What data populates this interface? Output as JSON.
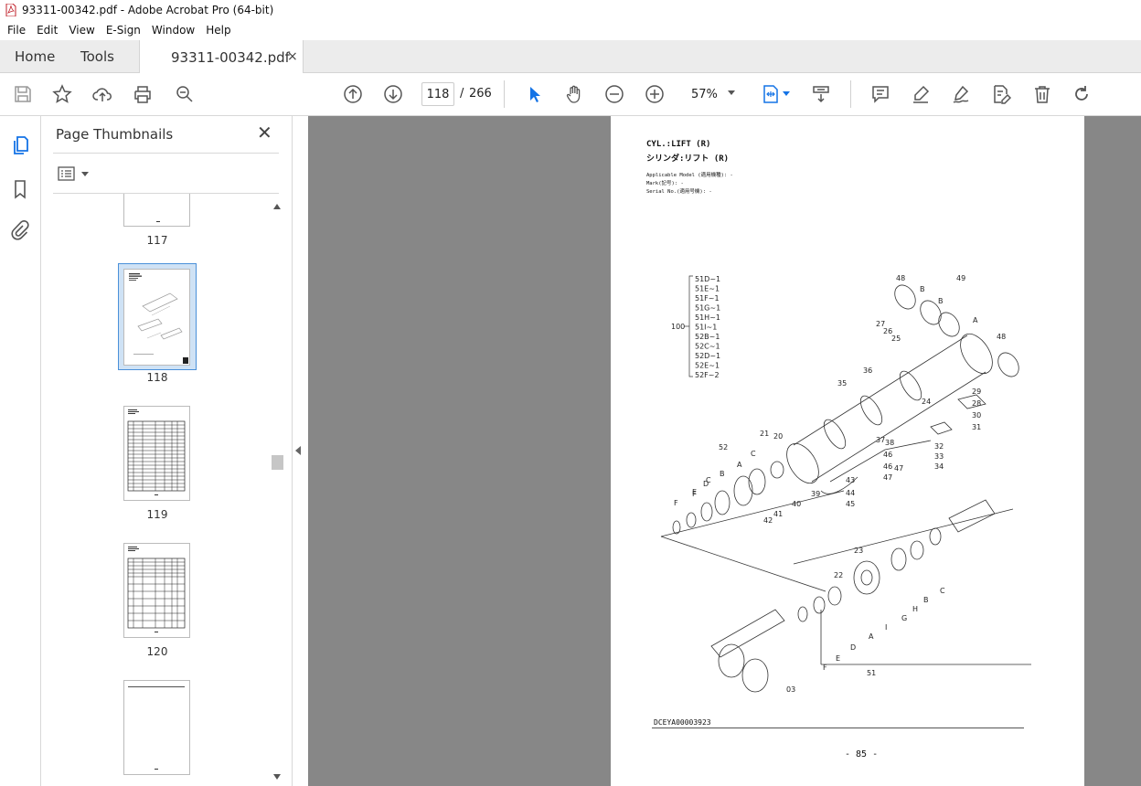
{
  "window": {
    "title": "93311-00342.pdf - Adobe Acrobat Pro (64-bit)"
  },
  "menu": [
    "File",
    "Edit",
    "View",
    "E-Sign",
    "Window",
    "Help"
  ],
  "tabs": {
    "home": "Home",
    "tools": "Tools",
    "document": "93311-00342.pdf",
    "close": "×"
  },
  "toolbar": {
    "page_current": "118",
    "page_sep": "/",
    "page_total": "266",
    "zoom": "57%"
  },
  "panel": {
    "title": "Page Thumbnails",
    "close": "✕",
    "thumbnails": [
      {
        "label": "117"
      },
      {
        "label": "118",
        "selected": true
      },
      {
        "label": "119"
      },
      {
        "label": "120"
      }
    ]
  },
  "document": {
    "heading_en": "CYL.:LIFT (R)",
    "heading_jp": "シリンダ:リフト (R)",
    "applicable_model": "Applicable Model (適用機種): -",
    "mark": "Mark(記号): -",
    "serial_no": "Serial No.(適用号機): -",
    "drawing_code": "DCEYA00003923",
    "page_number": "- 85 -",
    "group_label": "100",
    "group_items": [
      "51D~1",
      "51E~1",
      "51F~1",
      "51G~1",
      "51H~1",
      "51I~1",
      "52B~1",
      "52C~1",
      "52D~1",
      "52E~1",
      "52F~2"
    ],
    "callouts": [
      "48",
      "49",
      "B",
      "B",
      "A",
      "48",
      "27",
      "26",
      "25",
      "36",
      "35",
      "29",
      "28",
      "30",
      "31",
      "24",
      "37",
      "38",
      "32",
      "33",
      "34",
      "46",
      "47",
      "46",
      "47",
      "21",
      "20",
      "52",
      "C",
      "A",
      "B",
      "C",
      "D",
      "F",
      "F",
      "E",
      "43",
      "44",
      "45",
      "39",
      "40",
      "41",
      "42",
      "23",
      "22",
      "C",
      "B",
      "H",
      "G",
      "I",
      "A",
      "51",
      "D",
      "E",
      "F",
      "03"
    ]
  }
}
